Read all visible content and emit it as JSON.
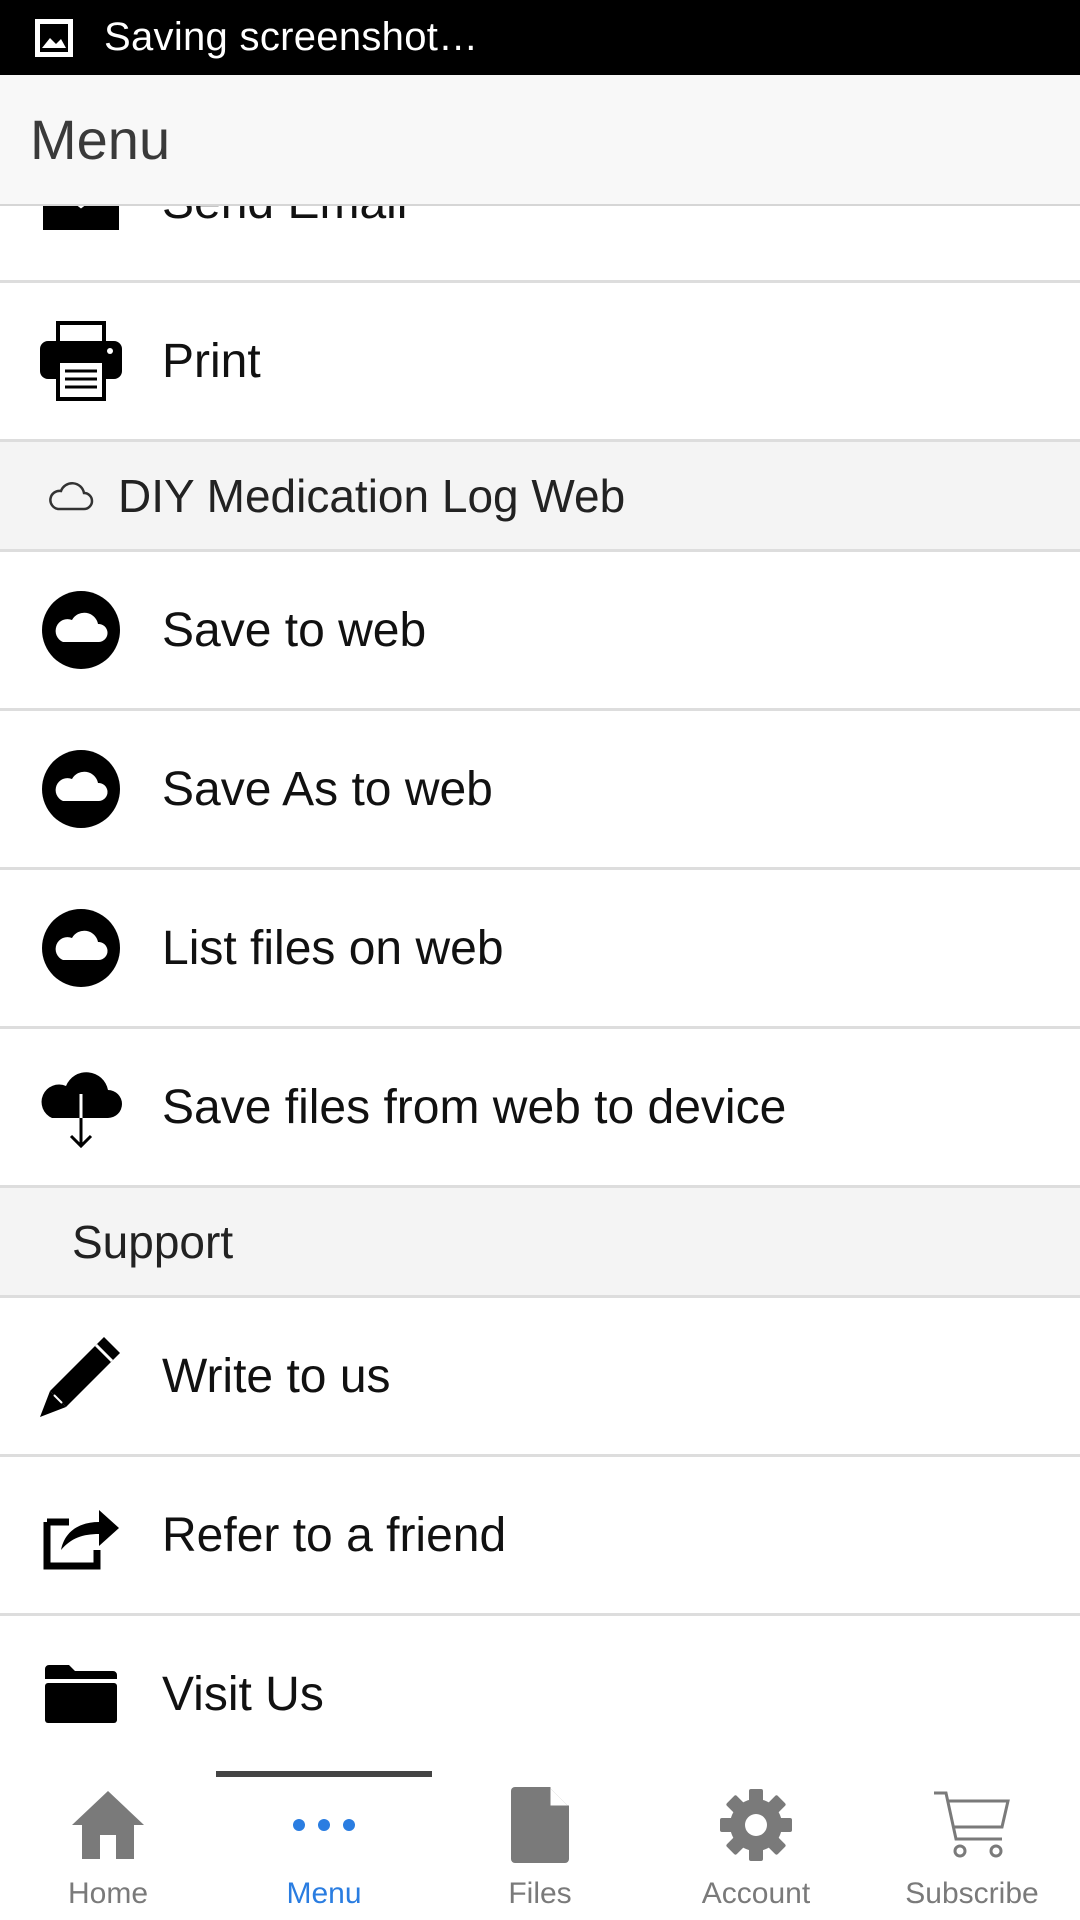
{
  "status_bar": {
    "text": "Saving screenshot…",
    "icon": "image-icon"
  },
  "header": {
    "title": "Menu"
  },
  "menu": {
    "partial_item": {
      "label": "Send Email",
      "icon": "envelope-icon"
    },
    "print": {
      "label": "Print",
      "icon": "printer-icon"
    },
    "web_section": {
      "label": "DIY Medication Log Web",
      "icon": "cloud-outline-icon"
    },
    "save_to_web": {
      "label": "Save to web",
      "icon": "cloud-circle-icon"
    },
    "save_as_to_web": {
      "label": "Save As to web",
      "icon": "cloud-circle-icon"
    },
    "list_files_on_web": {
      "label": "List files on web",
      "icon": "cloud-circle-icon"
    },
    "save_files_from_web": {
      "label": "Save files from web to device",
      "icon": "cloud-download-icon"
    },
    "support_section": {
      "label": "Support"
    },
    "write_to_us": {
      "label": "Write to us",
      "icon": "pencil-icon"
    },
    "refer_friend": {
      "label": "Refer to a friend",
      "icon": "share-icon"
    },
    "visit_us": {
      "label": "Visit Us",
      "icon": "folder-icon"
    }
  },
  "bottom_nav": {
    "items": [
      {
        "label": "Home",
        "icon": "home-icon"
      },
      {
        "label": "Menu",
        "icon": "more-dots-icon",
        "active": true
      },
      {
        "label": "Files",
        "icon": "file-icon"
      },
      {
        "label": "Account",
        "icon": "gear-icon"
      },
      {
        "label": "Subscribe",
        "icon": "cart-icon"
      }
    ]
  },
  "colors": {
    "accent": "#2a7de1",
    "status_bar": "#000000",
    "header_bg": "#f8f8f8",
    "section_bg": "#f4f4f4",
    "nav_inactive": "#7a7a7a"
  }
}
